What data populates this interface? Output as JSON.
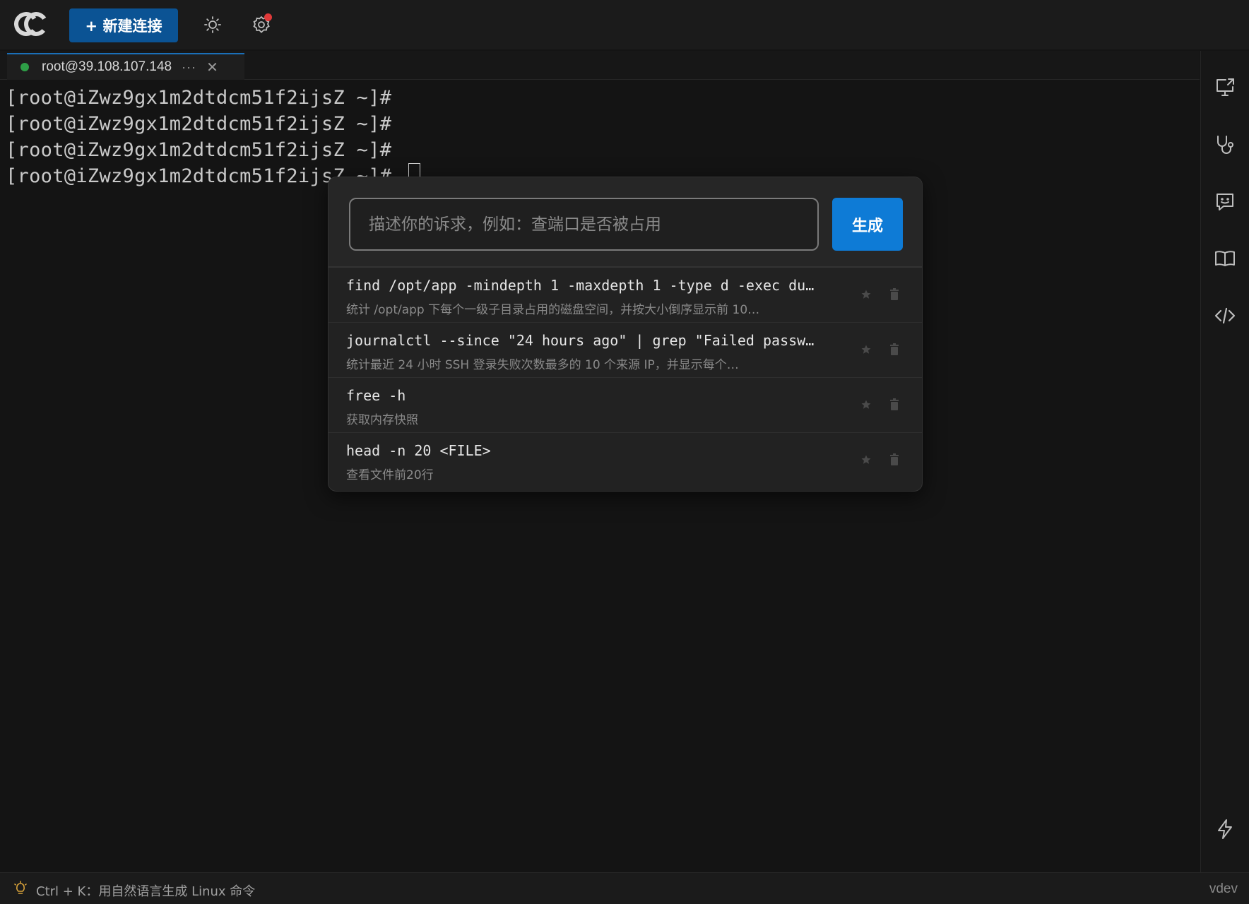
{
  "app": {
    "brand_icon": "cc-logo-icon"
  },
  "toolbar": {
    "new_connection_label": "+ 新建连接",
    "theme_icon": "sun-icon",
    "settings_icon": "gear-icon",
    "settings_has_notification": true,
    "accent_color": "#0b5394"
  },
  "tabs": [
    {
      "label": "root@39.108.107.148",
      "status": "connected",
      "status_color": "#2e9e47",
      "more": "···",
      "close": "✕"
    }
  ],
  "terminal": {
    "lines": [
      "[root@iZwz9gx1m2dtdcm51f2ijsZ ~]#",
      "[root@iZwz9gx1m2dtdcm51f2ijsZ ~]#",
      "[root@iZwz9gx1m2dtdcm51f2ijsZ ~]#",
      "[root@iZwz9gx1m2dtdcm51f2ijsZ ~]#"
    ]
  },
  "ai_popup": {
    "input_value": "",
    "input_placeholder": "描述你的诉求，例如：查端口是否被占用",
    "generate_label": "生成",
    "generate_color": "#0e7bd6",
    "history": [
      {
        "command": "find /opt/app -mindepth 1 -maxdepth 1 -type d -exec du…",
        "description": "统计 /opt/app 下每个一级子目录占用的磁盘空间，并按大小倒序显示前 10…"
      },
      {
        "command": "journalctl --since \"24 hours ago\" | grep \"Failed passw…",
        "description": "统计最近 24 小时 SSH 登录失败次数最多的 10 个来源 IP，并显示每个…"
      },
      {
        "command": "free -h",
        "description": "获取内存快照"
      },
      {
        "command": "head -n 20 <FILE>",
        "description": "查看文件前20行"
      }
    ]
  },
  "right_sidebar": {
    "items": [
      "monitor-share-icon",
      "stethoscope-icon",
      "chat-bot-icon",
      "book-icon",
      "code-icon"
    ],
    "bottom_item": "lightning-icon"
  },
  "statusbar": {
    "hint_icon": "lightbulb-icon",
    "hint": "Ctrl + K：用自然语言生成 Linux 命令",
    "user": "vdev"
  }
}
